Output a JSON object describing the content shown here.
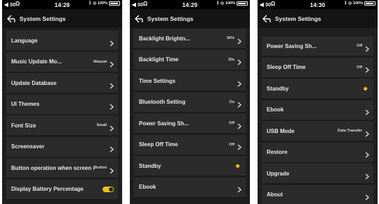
{
  "screens": [
    {
      "status": {
        "left": "◀ 30",
        "time": "14:28"
      },
      "title": "System Settings",
      "items": [
        {
          "label": "Language",
          "value": "",
          "control": "chevron"
        },
        {
          "label": "Music Update Mo...",
          "value": "Manual",
          "control": "chevron"
        },
        {
          "label": "Update Database",
          "value": "",
          "control": "chevron"
        },
        {
          "label": "UI Themes",
          "value": "",
          "control": "chevron"
        },
        {
          "label": "Font Size",
          "value": "Small",
          "control": "chevron"
        },
        {
          "label": "Screensaver",
          "value": "",
          "control": "chevron"
        },
        {
          "label": "Button operation when screen is off",
          "value": "Button",
          "control": "chevron"
        },
        {
          "label": "Display Battery Percentage",
          "value": "",
          "control": "toggle-on"
        }
      ]
    },
    {
      "status": {
        "left": "◀ 30",
        "time": "14:29"
      },
      "title": "System Settings",
      "items": [
        {
          "label": "Backlight Brightn...",
          "value": "50%",
          "control": "chevron"
        },
        {
          "label": "Backlight Time",
          "value": "30s",
          "control": "chevron"
        },
        {
          "label": "Time Settings",
          "value": "",
          "control": "chevron"
        },
        {
          "label": "Bluetooth Setting",
          "value": "On",
          "control": "chevron"
        },
        {
          "label": "Power Saving Sh...",
          "value": "Off",
          "control": "chevron"
        },
        {
          "label": "Sleep Off Time",
          "value": "Off",
          "control": "chevron"
        },
        {
          "label": "Standby",
          "value": "",
          "control": "dot"
        },
        {
          "label": "Ebook",
          "value": "",
          "control": "chevron"
        }
      ]
    },
    {
      "status": {
        "left": "◀ 30",
        "time": "14:30"
      },
      "title": "System Settings",
      "items": [
        {
          "label": "Power Saving Sh...",
          "value": "Off",
          "control": "chevron"
        },
        {
          "label": "Sleep Off Time",
          "value": "Off",
          "control": "chevron"
        },
        {
          "label": "Standby",
          "value": "",
          "control": "dot"
        },
        {
          "label": "Ebook",
          "value": "",
          "control": "chevron"
        },
        {
          "label": "USB Mode",
          "value": "Data Transfer",
          "control": "chevron"
        },
        {
          "label": "Restore",
          "value": "",
          "control": "chevron"
        },
        {
          "label": "Upgrade",
          "value": "",
          "control": "chevron"
        },
        {
          "label": "About",
          "value": "",
          "control": "chevron"
        }
      ]
    }
  ],
  "status_battery": "100%",
  "colors": {
    "accent": "#f0c20a",
    "background": "#1f1f1f",
    "row": "#2b2b2b"
  }
}
